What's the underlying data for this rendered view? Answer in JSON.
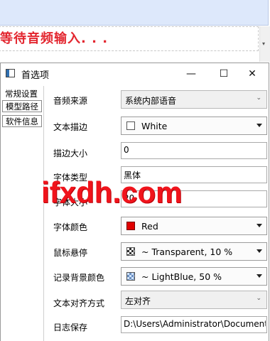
{
  "background": {
    "status_text": "等待音频输入. . .",
    "accent_color": "#e3262f"
  },
  "dialog": {
    "title": "首选项",
    "controls": {
      "minimize": "—",
      "maximize": "☐",
      "close": "✕"
    }
  },
  "nav": {
    "items": [
      {
        "label": "常规设置"
      },
      {
        "label": "模型路径"
      },
      {
        "label": "软件信息"
      }
    ]
  },
  "form": {
    "audio_source": {
      "label": "音频来源",
      "value": "系统内部语音"
    },
    "text_stroke": {
      "label": "文本描边",
      "value": "White",
      "swatch_color": "#ffffff"
    },
    "stroke_size": {
      "label": "描边大小",
      "value": "0"
    },
    "font_type": {
      "label": "字体类型",
      "value": "黑体"
    },
    "font_size": {
      "label": "字体大小",
      "value": "20"
    },
    "font_color": {
      "label": "字体颜色",
      "value": "Red",
      "swatch_color": "#e00000"
    },
    "mouse_hover": {
      "label": "鼠标悬停",
      "value": "~ Transparent, 10 %"
    },
    "record_bg_color": {
      "label": "记录背景颜色",
      "value": "~ LightBlue, 50 %"
    },
    "text_align": {
      "label": "文本对齐方式",
      "value": "左对齐"
    },
    "log_save": {
      "label": "日志保存",
      "value": "D:\\Users\\Administrator\\Documents"
    }
  },
  "watermark": {
    "text": "ifxdh.com"
  }
}
